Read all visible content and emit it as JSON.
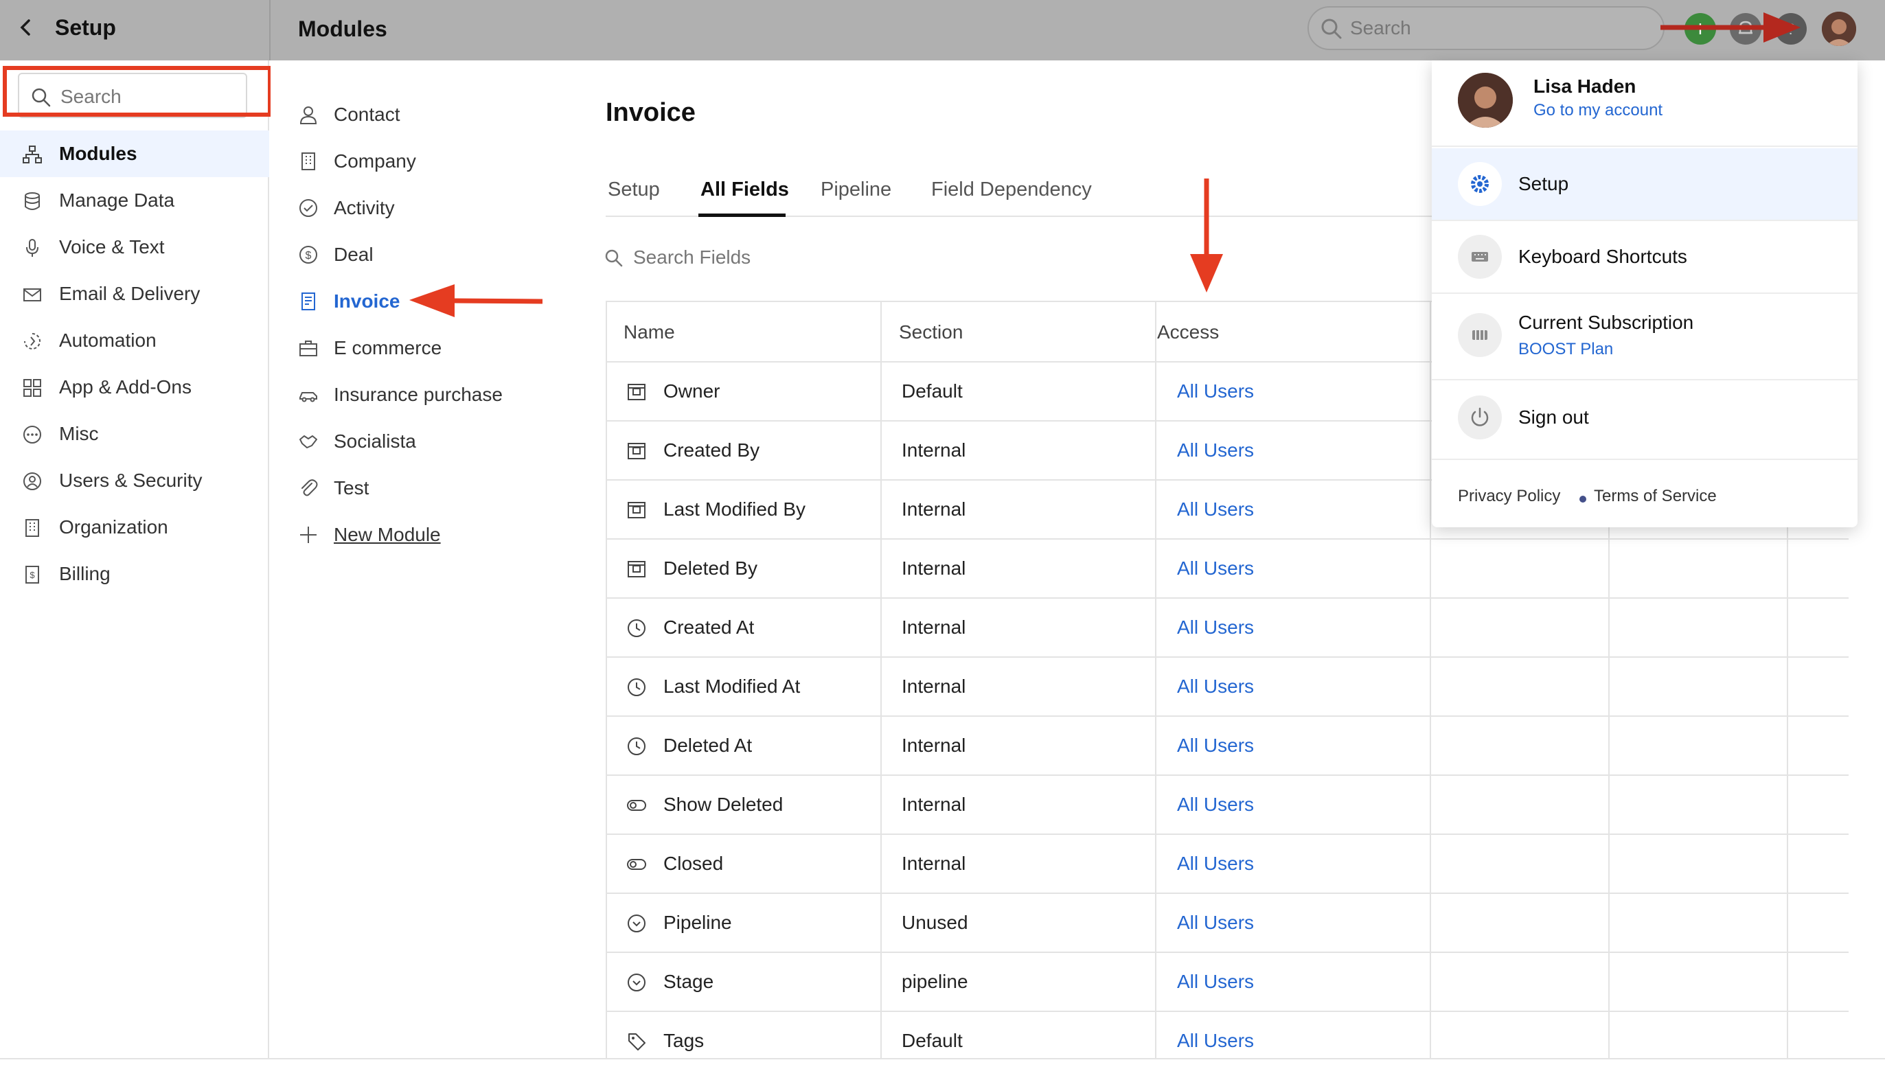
{
  "topbar": {
    "back_icon": "chevron-left-icon",
    "setup_title": "Setup",
    "section_title": "Modules",
    "search_placeholder": "Search",
    "icons": [
      "plus-icon",
      "bell-icon",
      "help-icon",
      "avatar"
    ]
  },
  "sidebar": {
    "search_placeholder": "Search",
    "items": [
      {
        "label": "Modules",
        "icon": "modules-icon",
        "active": true
      },
      {
        "label": "Manage Data",
        "icon": "database-icon"
      },
      {
        "label": "Voice & Text",
        "icon": "microphone-icon"
      },
      {
        "label": "Email & Delivery",
        "icon": "mail-icon"
      },
      {
        "label": "Automation",
        "icon": "automation-icon"
      },
      {
        "label": "App & Add-Ons",
        "icon": "grid-icon"
      },
      {
        "label": "Misc",
        "icon": "ellipsis-icon"
      },
      {
        "label": "Users & Security",
        "icon": "user-circle-icon"
      },
      {
        "label": "Organization",
        "icon": "building-icon"
      },
      {
        "label": "Billing",
        "icon": "billing-icon"
      }
    ]
  },
  "modules": {
    "items": [
      {
        "label": "Contact",
        "icon": "person-icon"
      },
      {
        "label": "Company",
        "icon": "building-icon"
      },
      {
        "label": "Activity",
        "icon": "check-circle-icon"
      },
      {
        "label": "Deal",
        "icon": "dollar-icon"
      },
      {
        "label": "Invoice",
        "icon": "invoice-icon",
        "active": true
      },
      {
        "label": "E commerce",
        "icon": "briefcase-icon"
      },
      {
        "label": "Insurance purchase",
        "icon": "car-icon"
      },
      {
        "label": "Socialista",
        "icon": "handshake-icon"
      },
      {
        "label": "Test",
        "icon": "paperclip-icon"
      }
    ],
    "new_module_label": "New Module"
  },
  "main": {
    "title": "Invoice",
    "tabs": [
      {
        "label": "Setup"
      },
      {
        "label": "All Fields",
        "active": true
      },
      {
        "label": "Pipeline"
      },
      {
        "label": "Field Dependency"
      }
    ],
    "search_fields_placeholder": "Search Fields",
    "table": {
      "headers": [
        "Name",
        "Section",
        "Access"
      ],
      "rows": [
        {
          "name": "Owner",
          "section": "Default",
          "access": "All Users",
          "icon": "user-field-icon"
        },
        {
          "name": "Created By",
          "section": "Internal",
          "access": "All Users",
          "icon": "user-field-icon"
        },
        {
          "name": "Last Modified By",
          "section": "Internal",
          "access": "All Users",
          "icon": "user-field-icon"
        },
        {
          "name": "Deleted By",
          "section": "Internal",
          "access": "All Users",
          "icon": "user-field-icon"
        },
        {
          "name": "Created At",
          "section": "Internal",
          "access": "All Users",
          "icon": "clock-icon"
        },
        {
          "name": "Last Modified At",
          "section": "Internal",
          "access": "All Users",
          "icon": "clock-icon"
        },
        {
          "name": "Deleted At",
          "section": "Internal",
          "access": "All Users",
          "icon": "clock-icon"
        },
        {
          "name": "Show Deleted",
          "section": "Internal",
          "access": "All Users",
          "icon": "toggle-icon"
        },
        {
          "name": "Closed",
          "section": "Internal",
          "access": "All Users",
          "icon": "toggle-icon"
        },
        {
          "name": "Pipeline",
          "section": "Unused",
          "access": "All Users",
          "icon": "chevron-circle-icon"
        },
        {
          "name": "Stage",
          "section": "pipeline",
          "access": "All Users",
          "icon": "chevron-circle-icon"
        },
        {
          "name": "Tags",
          "section": "Default",
          "access": "All Users",
          "icon": "tag-icon"
        }
      ]
    }
  },
  "account_menu": {
    "user_name": "Lisa Haden",
    "account_link": "Go to my account",
    "items": [
      {
        "label": "Setup",
        "icon": "gear-icon",
        "active": true
      },
      {
        "label": "Keyboard Shortcuts",
        "icon": "keyboard-icon"
      },
      {
        "label": "Current Subscription",
        "icon": "subscription-icon",
        "sub": "BOOST Plan"
      },
      {
        "label": "Sign out",
        "icon": "power-icon"
      }
    ],
    "privacy_label": "Privacy Policy",
    "terms_label": "Terms of Service"
  },
  "colors": {
    "accent": "#2366d1",
    "highlight_red": "#e53c21",
    "arrow_dark_red": "#b4281e"
  }
}
